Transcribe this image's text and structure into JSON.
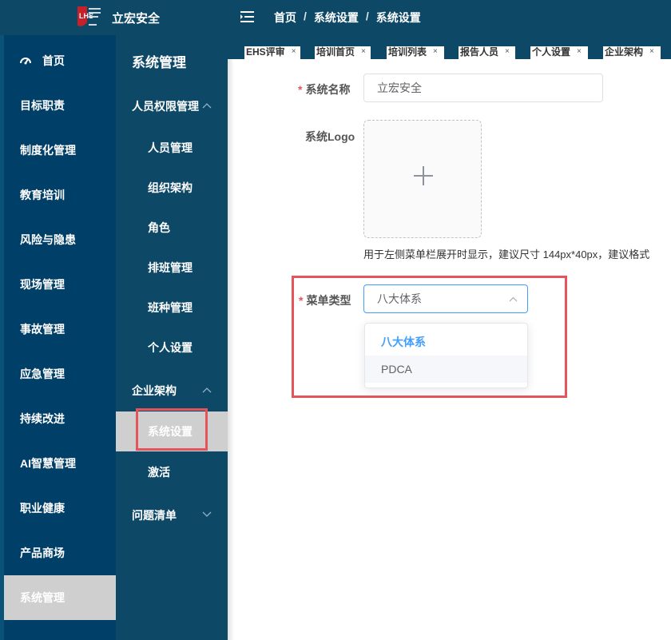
{
  "app": {
    "brand_name": "立宏安全",
    "logo_icon": "company-shield-logo-icon"
  },
  "breadcrumb": [
    "首页",
    "系统设置",
    "系统设置"
  ],
  "breadcrumb_sep": "/",
  "tabs": [
    {
      "label": "EHS评审"
    },
    {
      "label": "培训首页"
    },
    {
      "label": "培训列表"
    },
    {
      "label": "报告人员"
    },
    {
      "label": "个人设置"
    },
    {
      "label": "企业架构"
    }
  ],
  "tab_close": "×",
  "primary_nav": [
    {
      "label": "首页",
      "icon": "dashboard-icon"
    },
    {
      "label": "目标职责"
    },
    {
      "label": "制度化管理"
    },
    {
      "label": "教育培训"
    },
    {
      "label": "风险与隐患"
    },
    {
      "label": "现场管理"
    },
    {
      "label": "事故管理"
    },
    {
      "label": "应急管理"
    },
    {
      "label": "持续改进"
    },
    {
      "label": "AI智慧管理"
    },
    {
      "label": "职业健康"
    },
    {
      "label": "产品商场"
    },
    {
      "label": "系统管理",
      "active": true
    }
  ],
  "secondary_nav": {
    "title": "系统管理",
    "groups": [
      {
        "label": "人员权限管理",
        "expanded": true,
        "items": [
          "人员管理",
          "组织架构",
          "角色",
          "排班管理",
          "班种管理",
          "个人设置"
        ]
      },
      {
        "label": "企业架构",
        "expanded": true,
        "items": [
          "系统设置",
          "激活"
        ]
      },
      {
        "label": "问题清单",
        "expanded": false,
        "items": []
      }
    ],
    "active_item": "系统设置"
  },
  "form": {
    "system_name": {
      "label": "系统名称",
      "required_mark": "*",
      "value": "立宏安全"
    },
    "system_logo": {
      "label": "系统Logo",
      "hint": "用于左侧菜单栏展开时显示，建议尺寸 144px*40px，建议格式"
    },
    "menu_type": {
      "label": "菜单类型",
      "required_mark": "*",
      "value": "八大体系",
      "options": [
        "八大体系",
        "PDCA"
      ],
      "selected": "八大体系",
      "hovered": "PDCA"
    }
  },
  "colors": {
    "header_bg": "#0d4866",
    "primary_nav_bg": "#003f68",
    "active_bg": "#cfcfcf",
    "highlight_red": "#e5545b",
    "accent_blue": "#409eff"
  }
}
